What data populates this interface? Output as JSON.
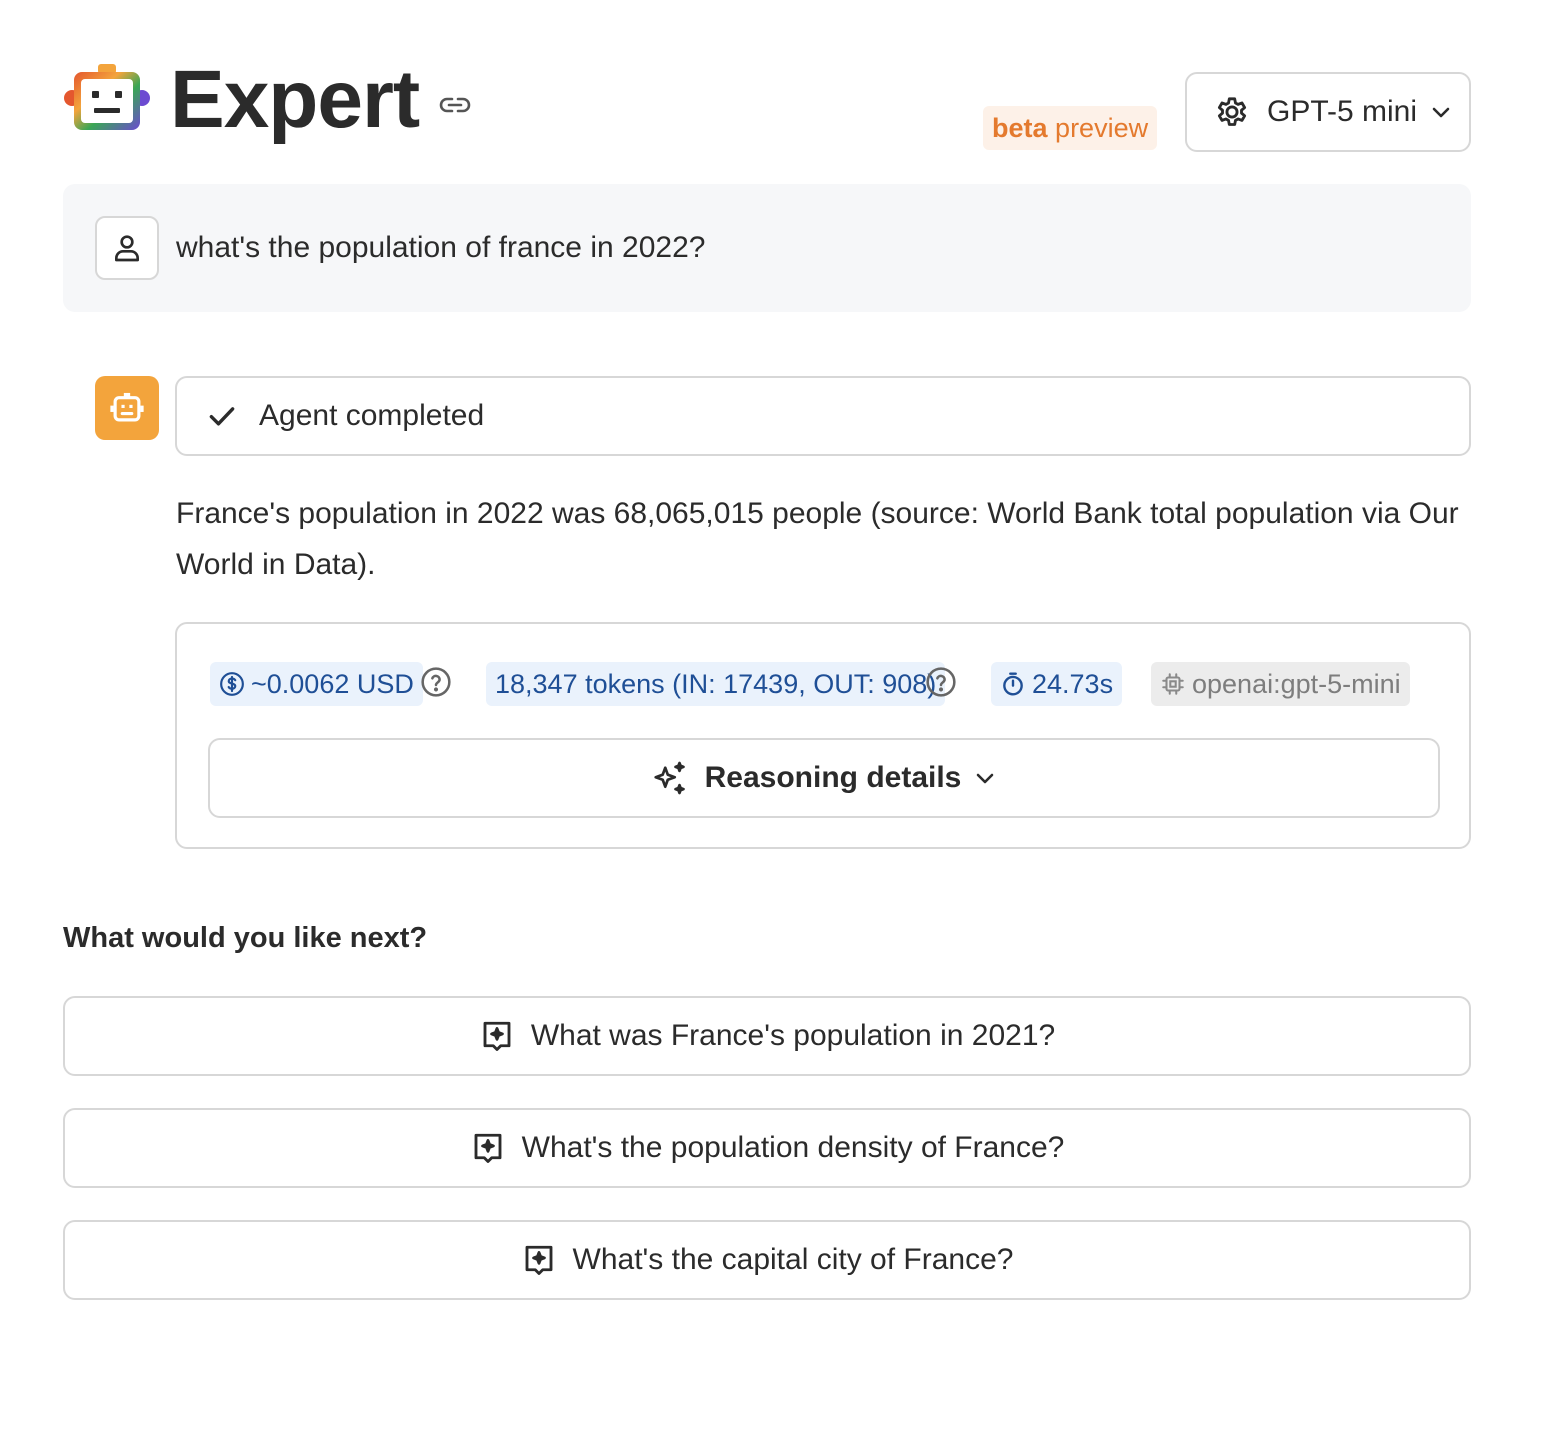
{
  "header": {
    "title": "Expert",
    "beta_word": "beta",
    "preview_word": "preview",
    "model_label": "GPT-5 mini"
  },
  "user_message": {
    "text": "what's the population of france in 2022?"
  },
  "agent": {
    "status": "Agent completed",
    "answer": "France's population in 2022 was 68,065,015 people (source: World Bank total population via Our World in Data).",
    "cost": "~0.0062 USD",
    "tokens": "18,347 tokens (IN: 17439, OUT: 908)",
    "duration": "24.73s",
    "model_id": "openai:gpt-5-mini",
    "reasoning_label": "Reasoning details"
  },
  "next": {
    "heading": "What would you like next?",
    "suggestions": [
      "What was France's population in 2021?",
      "What's the population density of France?",
      "What's the capital city of France?"
    ]
  },
  "colors": {
    "bot_avatar": "#f3a43c",
    "beta_text": "#e47a2e",
    "chip_blue_bg": "#eaf2fc",
    "chip_blue_text": "#1f4f96"
  }
}
